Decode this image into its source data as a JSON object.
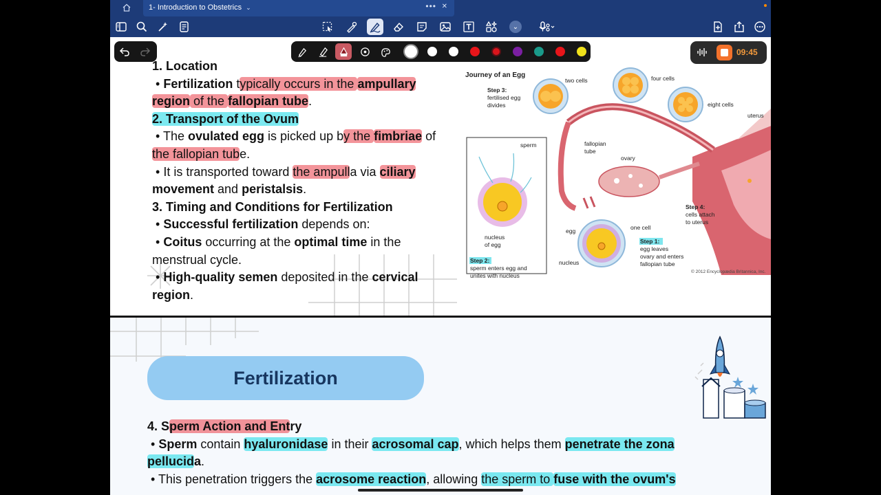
{
  "titlebar": {
    "document_title": "1- Introduction to Obstetrics",
    "chevron": "⌄",
    "dots": "•••",
    "close": "✕"
  },
  "colors": {
    "titlebar_bg": "#1d3b78",
    "highlight_red": "#ec5a64",
    "highlight_cyan": "#50e1eb",
    "pill_bg": "#94cbf2",
    "record_accent": "#f3722c"
  },
  "toolbar": {
    "left_icons": [
      "sidebar-icon",
      "search-icon",
      "magic-icon",
      "document-list-icon"
    ],
    "center_icons": [
      "lasso-select-icon",
      "shapes-icon",
      "pen-icon",
      "eraser-icon",
      "sticky-note-icon",
      "image-icon",
      "text-box-icon",
      "elements-icon"
    ],
    "more_chevron": "⌄",
    "right_icons": [
      "new-page-icon",
      "share-icon",
      "more-icon"
    ]
  },
  "pen_toolbar": {
    "tools": [
      "fountain-pen-icon",
      "ballpoint-pen-icon",
      "highlighter-icon",
      "laser-pointer-icon",
      "pen-settings-icon"
    ],
    "swatches": [
      "#ffffff",
      "#ffffff",
      "#ffffff",
      "#e8151a",
      "#d9151c",
      "#7b1fa2",
      "#1a9a8a",
      "#e8151a",
      "#f1e21b"
    ]
  },
  "recording": {
    "time": "09:45"
  },
  "slide1": {
    "heading1": "1. Location",
    "l1": {
      "a": "• ",
      "b": "Fertilization",
      "c": " t",
      "d": "ypically occurs in the ",
      "e": "ampullary"
    },
    "l2": {
      "a": "region",
      "b": " of the ",
      "c": "fallopian tube",
      "d": "."
    },
    "heading2": "2. Transport of the Ovum",
    "l3": {
      "a": "• The ",
      "b": "ovulated egg",
      "c": " is picked up b",
      "d": "y the ",
      "e": "fimbriae",
      "f": " of"
    },
    "l4": {
      "a": "the fallopian tub",
      "b": "e."
    },
    "l5": {
      "a": "• It is transported toward ",
      "b": "the ampull",
      "c": "a via ",
      "d": "ciliary"
    },
    "l6": {
      "a": "movement",
      "b": " and ",
      "c": "peristalsis",
      "d": "."
    },
    "heading3": "3. Timing and Conditions for Fertilization",
    "l7": {
      "a": "• ",
      "b": "Successful fertilization",
      "c": " depends on:"
    },
    "l8": {
      "a": "• ",
      "b": "Coitus",
      "c": " occurring at the ",
      "d": "optimal time",
      "e": " in the"
    },
    "l9": "menstrual cycle.",
    "l10": {
      "a": "• ",
      "b": "High-quality semen",
      "c": " deposited in the ",
      "d": "cervical"
    },
    "l11": {
      "a": "region",
      "b": "."
    }
  },
  "figure": {
    "title": "Journey of an Egg",
    "step3": "Step 3:",
    "step3_desc1": "fertilised egg",
    "step3_desc2": "divides",
    "two_cells": "two cells",
    "four_cells": "four cells",
    "eight_cells": "eight cells",
    "uterus": "uterus",
    "sperm": "sperm",
    "fallopian_tube1": "fallopian",
    "fallopian_tube2": "tube",
    "ovary": "ovary",
    "step4": "Step 4:",
    "step4_desc1": "cells attach",
    "step4_desc2": "to uterus",
    "nucleus_of_egg1": "nucleus",
    "nucleus_of_egg2": "of egg",
    "egg": "egg",
    "one_cell": "one cell",
    "step1": "Step 1:",
    "step1_desc1": "egg leaves",
    "step1_desc2": "ovary and enters",
    "step1_desc3": "fallopian tube",
    "nucleus": "nucleus",
    "step2": "Step 2:",
    "step2_desc1": "sperm enters egg and",
    "step2_desc2": "unites with nucleus",
    "copyright": "© 2012 Encyclopædia Britannica, Inc."
  },
  "slide2": {
    "title": "Fertilization",
    "heading4": {
      "a": "4. S",
      "b": "perm Action and Ent",
      "c": "ry"
    },
    "l1": {
      "a": "• ",
      "b": "Sperm",
      "c": " contain ",
      "d": "hyaluronidase",
      "e": " in their ",
      "f": "acrosomal cap",
      "g": ", which helps them ",
      "h": "penetrate the zona"
    },
    "l2": {
      "a": "pellucid",
      "b": "a",
      "c": "."
    },
    "l3": {
      "a": "• This penetration triggers the ",
      "b": "acrosome reaction",
      "c": ", allowing ",
      "d": "the sperm to ",
      "e": "fuse with the ovum's"
    }
  }
}
